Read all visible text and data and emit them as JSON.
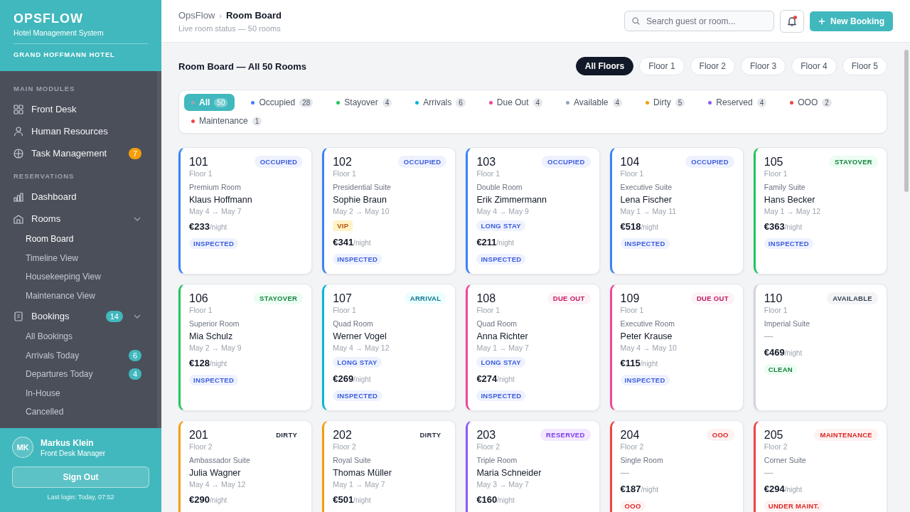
{
  "sidebar": {
    "brand": "OPSFLOW",
    "subtitle": "Hotel Management System",
    "hotel": "GRAND HOFFMANN HOTEL",
    "sections": [
      {
        "title": "MAIN MODULES",
        "items": [
          {
            "label": "Front Desk",
            "selected": false
          },
          {
            "label": "Human Resources",
            "selected": false
          },
          {
            "label": "Task Management",
            "selected": false,
            "badge": "7"
          }
        ]
      },
      {
        "title": "RESERVATIONS",
        "items": [
          {
            "label": "Dashboard",
            "selected": false
          },
          {
            "label": "Rooms",
            "selected": false,
            "expanded": true,
            "children": [
              {
                "label": "Room Board",
                "selected": true
              },
              {
                "label": "Timeline View",
                "selected": false
              },
              {
                "label": "Housekeeping View",
                "selected": false
              },
              {
                "label": "Maintenance View",
                "selected": false
              }
            ]
          },
          {
            "label": "Bookings",
            "selected": false,
            "expanded": true,
            "badge": "14",
            "children": [
              {
                "label": "All Bookings",
                "selected": false
              },
              {
                "label": "Arrivals Today",
                "selected": false,
                "badge": "6"
              },
              {
                "label": "Departures Today",
                "selected": false,
                "badge": "4"
              },
              {
                "label": "In-House",
                "selected": false
              },
              {
                "label": "Cancelled",
                "selected": false
              }
            ]
          }
        ]
      }
    ],
    "user": {
      "initials": "MK",
      "name": "Markus Klein",
      "role": "Front Desk Manager"
    },
    "sign_out": "Sign Out",
    "last_login": "Last login: Today, 07:52"
  },
  "header": {
    "breadcrumb": [
      "OpsFlow",
      "Room Board"
    ],
    "separator": "›",
    "subtitle": "Live room status — 50 rooms",
    "search": {
      "placeholder": "Search guest or room..."
    },
    "notifications": {
      "unread": true
    },
    "new_button": "New Booking"
  },
  "board": {
    "title": "Room Board — All 50 Rooms",
    "floors": [
      {
        "label": "All Floors",
        "selected": true
      },
      {
        "label": "Floor 1",
        "selected": false
      },
      {
        "label": "Floor 2",
        "selected": false
      },
      {
        "label": "Floor 3",
        "selected": false
      },
      {
        "label": "Floor 4",
        "selected": false
      },
      {
        "label": "Floor 5",
        "selected": false
      }
    ],
    "filters": [
      {
        "label": "All",
        "count": "50",
        "color": "#9ca3af",
        "selected": true
      },
      {
        "label": "Occupied",
        "count": "28",
        "color": "#3b82f6",
        "selected": false
      },
      {
        "label": "Stayover",
        "count": "4",
        "color": "#22c55e",
        "selected": false
      },
      {
        "label": "Arrivals",
        "count": "6",
        "color": "#06b6d4",
        "selected": false
      },
      {
        "label": "Due Out",
        "count": "4",
        "color": "#ec4899",
        "selected": false
      },
      {
        "label": "Available",
        "count": "4",
        "color": "#94a3b8",
        "selected": false
      },
      {
        "label": "Dirty",
        "count": "5",
        "color": "#f59e0b",
        "selected": false
      },
      {
        "label": "Reserved",
        "count": "4",
        "color": "#8b5cf6",
        "selected": false
      },
      {
        "label": "OOO",
        "count": "2",
        "color": "#ef4444",
        "selected": false
      },
      {
        "label": "Maintenance",
        "count": "1",
        "color": "#ef4444",
        "selected": false
      }
    ],
    "rooms": [
      {
        "number": "101",
        "floor": "Floor 1",
        "status": "OCCUPIED",
        "kind": "occupied",
        "type": "Premium Room",
        "guest": "Klaus Hoffmann",
        "dates": "May 4 → May 7",
        "price": "€233",
        "per": "/night",
        "tags": [
          {
            "label": "INSPECTED",
            "kind": "blue"
          }
        ]
      },
      {
        "number": "102",
        "floor": "Floor 1",
        "status": "OCCUPIED",
        "kind": "occupied",
        "type": "Presidential Suite",
        "guest": "Sophie Braun",
        "dates": "May 2 → May 10",
        "extra": {
          "label": "VIP",
          "kind": "yellow"
        },
        "price": "€341",
        "per": "/night",
        "tags": [
          {
            "label": "INSPECTED",
            "kind": "blue"
          }
        ]
      },
      {
        "number": "103",
        "floor": "Floor 1",
        "status": "OCCUPIED",
        "kind": "occupied",
        "type": "Double Room",
        "guest": "Erik Zimmermann",
        "dates": "May 4 → May 9",
        "extra": {
          "label": "LONG STAY",
          "kind": "blue"
        },
        "price": "€211",
        "per": "/night",
        "tags": [
          {
            "label": "INSPECTED",
            "kind": "blue"
          }
        ]
      },
      {
        "number": "104",
        "floor": "Floor 1",
        "status": "OCCUPIED",
        "kind": "occupied",
        "type": "Executive Suite",
        "guest": "Lena Fischer",
        "dates": "May 1 → May 11",
        "price": "€518",
        "per": "/night",
        "tags": [
          {
            "label": "INSPECTED",
            "kind": "blue"
          }
        ]
      },
      {
        "number": "105",
        "floor": "Floor 1",
        "status": "STAYOVER",
        "kind": "stayover",
        "type": "Family Suite",
        "guest": "Hans Becker",
        "dates": "May 1 → May 12",
        "price": "€363",
        "per": "/night",
        "tags": [
          {
            "label": "INSPECTED",
            "kind": "blue"
          }
        ]
      },
      {
        "number": "106",
        "floor": "Floor 1",
        "status": "STAYOVER",
        "kind": "stayover",
        "type": "Superior Room",
        "guest": "Mia Schulz",
        "dates": "May 2 → May 9",
        "price": "€128",
        "per": "/night",
        "tags": [
          {
            "label": "INSPECTED",
            "kind": "blue"
          }
        ]
      },
      {
        "number": "107",
        "floor": "Floor 1",
        "status": "ARRIVAL",
        "kind": "arrival",
        "type": "Quad Room",
        "guest": "Werner Vogel",
        "dates": "May 4 → May 12",
        "extra": {
          "label": "LONG STAY",
          "kind": "blue"
        },
        "price": "€269",
        "per": "/night",
        "tags": [
          {
            "label": "INSPECTED",
            "kind": "blue"
          }
        ]
      },
      {
        "number": "108",
        "floor": "Floor 1",
        "status": "DUE OUT",
        "kind": "dueout",
        "type": "Quad Room",
        "guest": "Anna Richter",
        "dates": "May 1 → May 7",
        "extra": {
          "label": "LONG STAY",
          "kind": "blue"
        },
        "price": "€274",
        "per": "/night",
        "tags": [
          {
            "label": "INSPECTED",
            "kind": "blue"
          }
        ]
      },
      {
        "number": "109",
        "floor": "Floor 1",
        "status": "DUE OUT",
        "kind": "dueout",
        "type": "Executive Room",
        "guest": "Peter Krause",
        "dates": "May 4 → May 10",
        "price": "€115",
        "per": "/night",
        "tags": [
          {
            "label": "INSPECTED",
            "kind": "blue"
          }
        ]
      },
      {
        "number": "110",
        "floor": "Floor 1",
        "status": "AVAILABLE",
        "kind": "available",
        "type": "Imperial Suite",
        "guest": "—",
        "price": "€469",
        "per": "/night",
        "tags": [
          {
            "label": "CLEAN",
            "kind": "green"
          }
        ]
      },
      {
        "number": "201",
        "floor": "Floor 2",
        "status": "DIRTY",
        "kind": "dirty",
        "type": "Ambassador Suite",
        "guest": "Julia Wagner",
        "dates": "May 4 → May 12",
        "price": "€290",
        "per": "/night"
      },
      {
        "number": "202",
        "floor": "Floor 2",
        "status": "DIRTY",
        "kind": "dirty",
        "type": "Royal Suite",
        "guest": "Thomas Müller",
        "dates": "May 1 → May 7",
        "price": "€501",
        "per": "/night"
      },
      {
        "number": "203",
        "floor": "Floor 2",
        "status": "RESERVED",
        "kind": "reserved",
        "type": "Triple Room",
        "guest": "Maria Schneider",
        "dates": "May 3 → May 7",
        "price": "€160",
        "per": "/night"
      },
      {
        "number": "204",
        "floor": "Floor 2",
        "status": "OOO",
        "kind": "ooo",
        "type": "Single Room",
        "guest": "—",
        "price": "€187",
        "per": "/night",
        "tags": [
          {
            "label": "OOO",
            "kind": "red"
          }
        ]
      },
      {
        "number": "205",
        "floor": "Floor 2",
        "status": "MAINTENANCE",
        "kind": "maintenance",
        "type": "Corner Suite",
        "guest": "—",
        "price": "€294",
        "per": "/night",
        "tags": [
          {
            "label": "UNDER MAINT.",
            "kind": "red"
          }
        ]
      }
    ]
  }
}
